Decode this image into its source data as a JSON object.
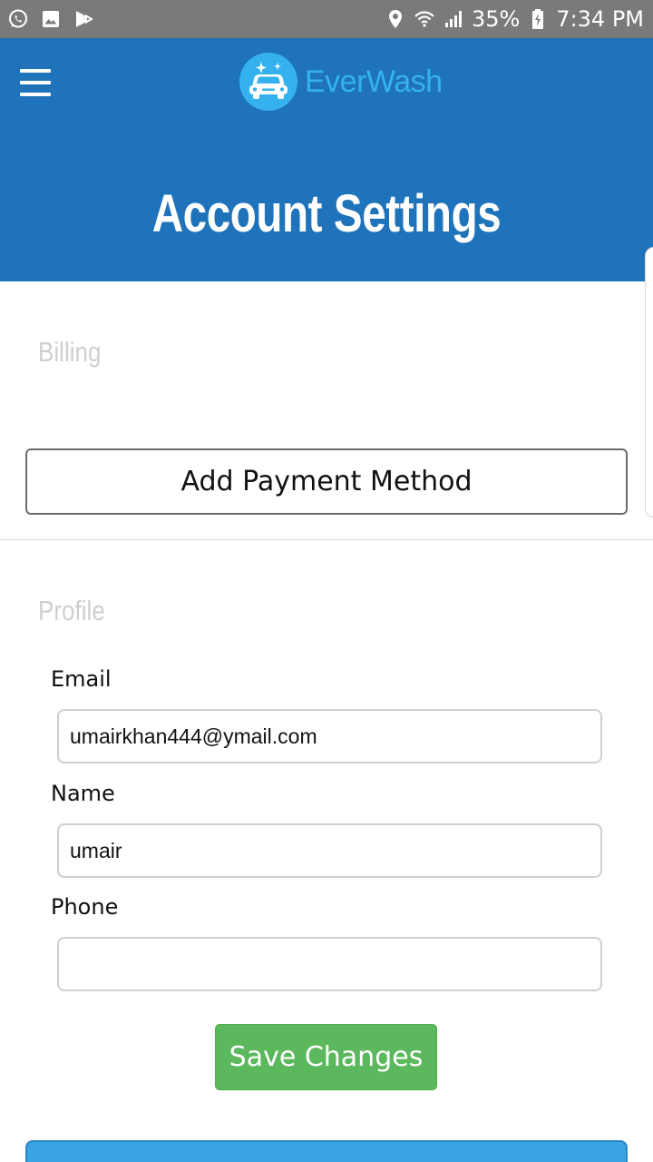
{
  "status_bar": {
    "left_icons": [
      "whatsapp-icon",
      "gallery-icon",
      "play-store-icon"
    ],
    "right_icons": [
      "location-icon",
      "wifi-icon",
      "signal-icon",
      "battery-charging-icon"
    ],
    "battery_percent": "35%",
    "time": "7:34 PM",
    "background": "#7a7a7a"
  },
  "header": {
    "background": "#1e73ba",
    "logo_text": "EverWash",
    "logo_color": "#35b2ee",
    "title": "Account Settings"
  },
  "billing": {
    "label": "Billing",
    "add_payment_label": "Add Payment Method"
  },
  "profile": {
    "label": "Profile",
    "email_label": "Email",
    "email_value": "umairkhan444@ymail.com",
    "name_label": "Name",
    "name_value": "umair",
    "phone_label": "Phone",
    "phone_value": "",
    "save_label": "Save Changes",
    "save_color": "#5cb85c"
  }
}
